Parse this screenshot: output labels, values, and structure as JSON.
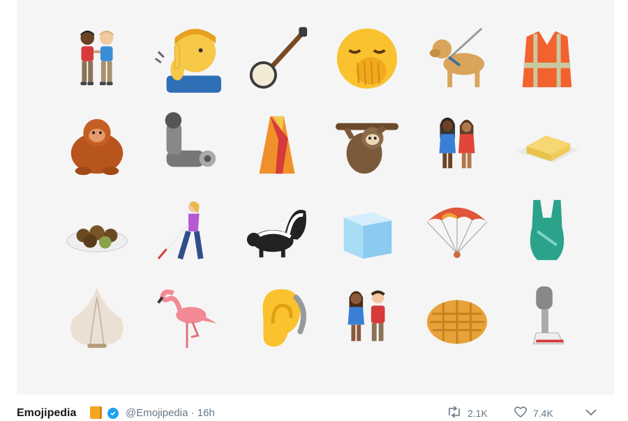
{
  "emoji_grid": {
    "rows": [
      [
        "men-holding-hands",
        "deaf-person",
        "banjo",
        "yawning-face",
        "guide-dog",
        "safety-vest"
      ],
      [
        "orangutan",
        "mechanical-arm",
        "sari",
        "sloth",
        "women-holding-hands",
        "butter"
      ],
      [
        "falafel",
        "person-with-white-cane",
        "skunk",
        "ice-cube",
        "parachute",
        "one-piece-swimsuit"
      ],
      [
        "garlic",
        "flamingo",
        "ear-with-hearing-aid",
        "woman-and-man-holding-hands",
        "waffle",
        "mechanical-leg"
      ]
    ]
  },
  "tweet": {
    "author": "Emojipedia",
    "handle": "@Emojipedia · 16h",
    "retweets": "2.1K",
    "likes": "7.4K"
  },
  "colors": {
    "card_background": "#f5f5f5",
    "verified": "#1da1f2",
    "muted_text": "#657786"
  }
}
